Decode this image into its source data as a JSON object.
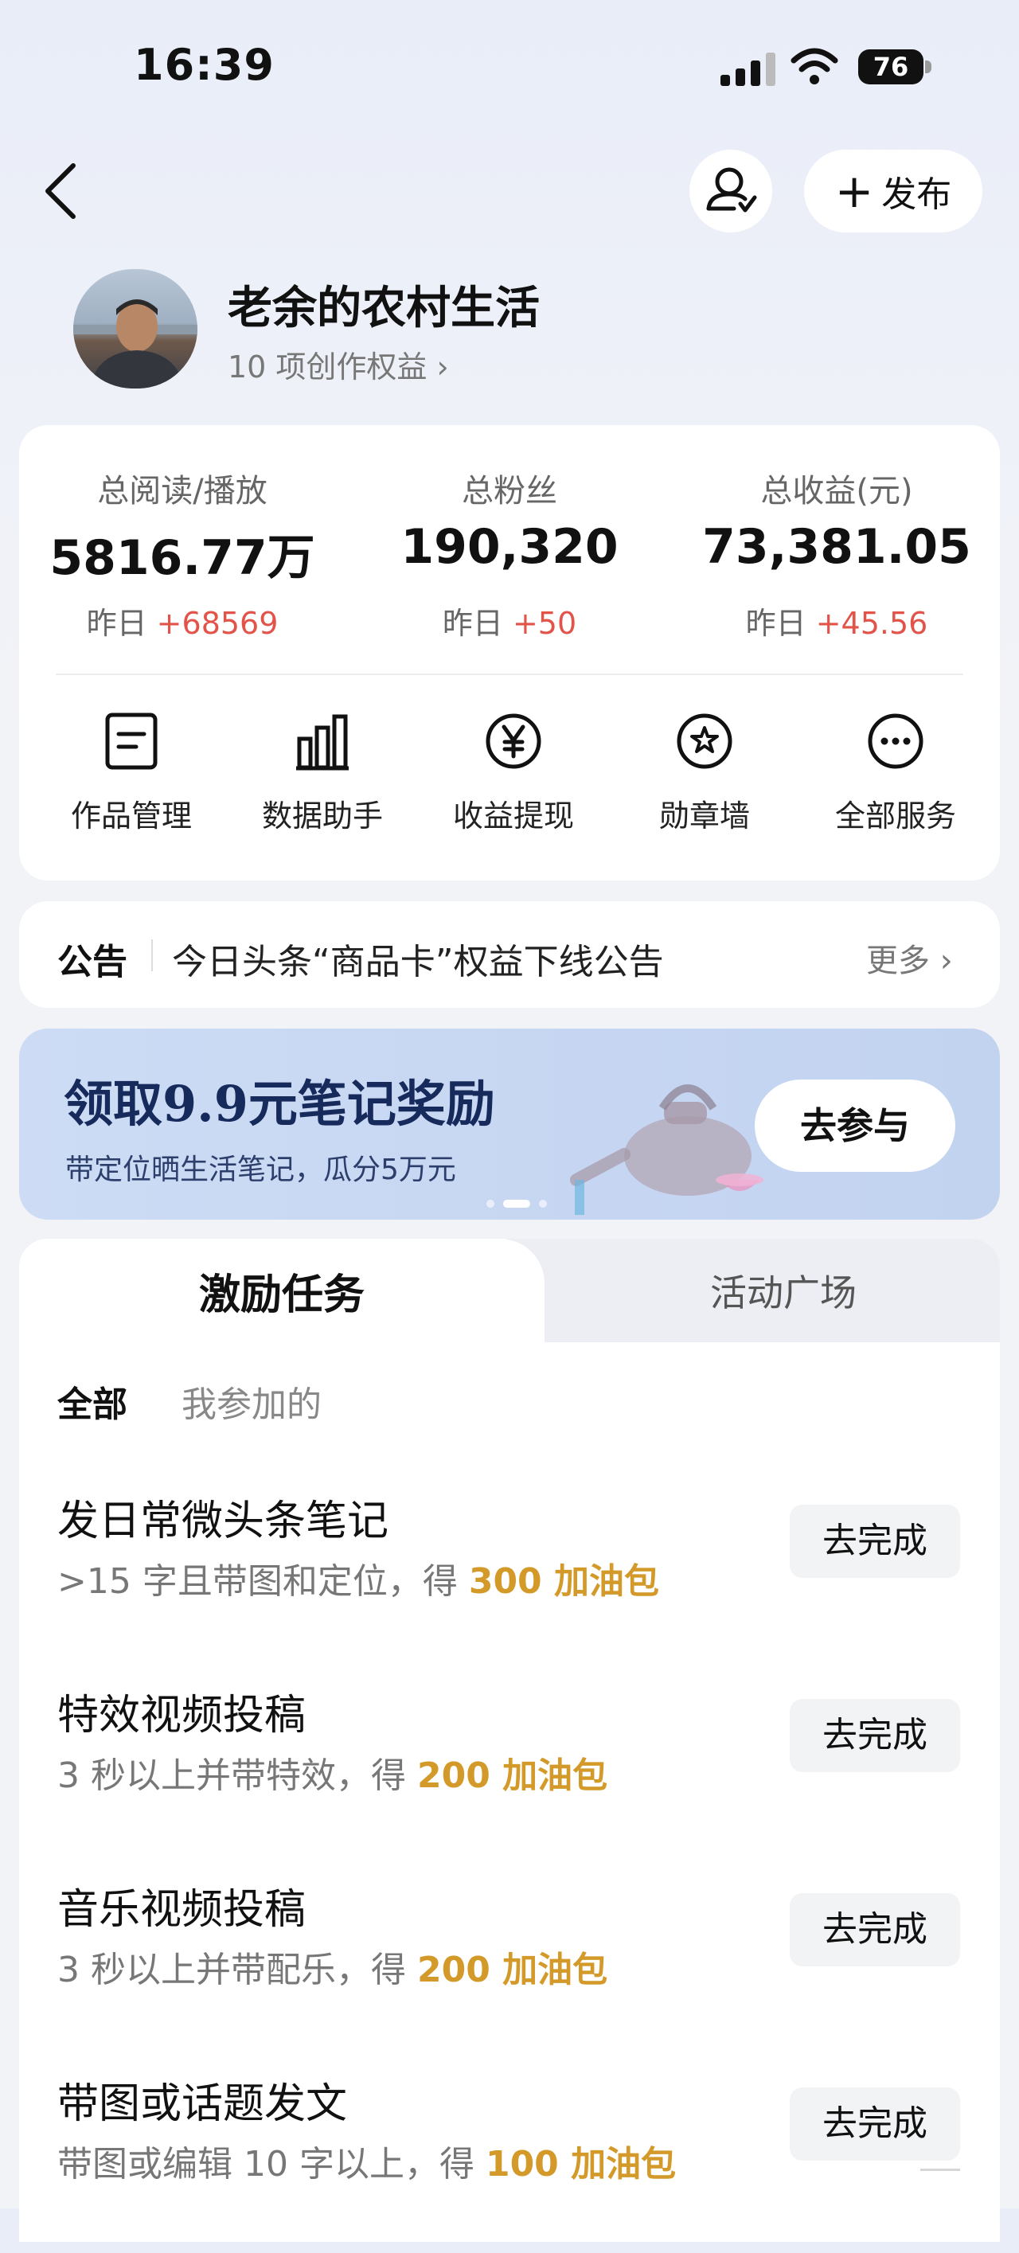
{
  "status_bar": {
    "time": "16:39",
    "battery": "76"
  },
  "header": {
    "publish_label": "发布"
  },
  "profile": {
    "name": "老余的农村生活",
    "rights_link": "10 项创作权益 ›"
  },
  "stats": [
    {
      "label": "总阅读/播放",
      "value": "5816.77万",
      "delta_prefix": "昨日 ",
      "delta": "+68569"
    },
    {
      "label": "总粉丝",
      "value": "190,320",
      "delta_prefix": "昨日 ",
      "delta": "+50"
    },
    {
      "label": "总收益(元)",
      "value": "73,381.05",
      "delta_prefix": "昨日 ",
      "delta": "+45.56"
    }
  ],
  "services": [
    {
      "label": "作品管理",
      "icon": "document-icon"
    },
    {
      "label": "数据助手",
      "icon": "bar-chart-icon"
    },
    {
      "label": "收益提现",
      "icon": "yen-icon"
    },
    {
      "label": "勋章墙",
      "icon": "medal-icon"
    },
    {
      "label": "全部服务",
      "icon": "more-icon"
    }
  ],
  "notice": {
    "title": "公告",
    "text": "今日头条“商品卡”权益下线公告",
    "more": "更多 ›"
  },
  "banner": {
    "title": "领取9.9元笔记奖励",
    "subtitle": "带定位晒生活笔记，瓜分5万元",
    "cta": "去参与"
  },
  "tabs": {
    "active": "激励任务",
    "inactive": "活动广场"
  },
  "filters": {
    "all": "全部",
    "mine": "我参加的"
  },
  "tasks": [
    {
      "title": "发日常微头条笔记",
      "desc": ">15 字且带图和定位，得 ",
      "reward": "300 加油包",
      "button": "去完成"
    },
    {
      "title": "特效视频投稿",
      "desc": "3 秒以上并带特效，得 ",
      "reward": "200 加油包",
      "button": "去完成"
    },
    {
      "title": "音乐视频投稿",
      "desc": "3 秒以上并带配乐，得 ",
      "reward": "200 加油包",
      "button": "去完成"
    },
    {
      "title": "带图或话题发文",
      "desc": "带图或编辑 10 字以上，得 ",
      "reward": "100 加油包",
      "button": "去完成"
    }
  ],
  "colors": {
    "accent_red": "#e2534a",
    "reward_gold": "#d39a2a",
    "banner_navy": "#162a5c"
  }
}
